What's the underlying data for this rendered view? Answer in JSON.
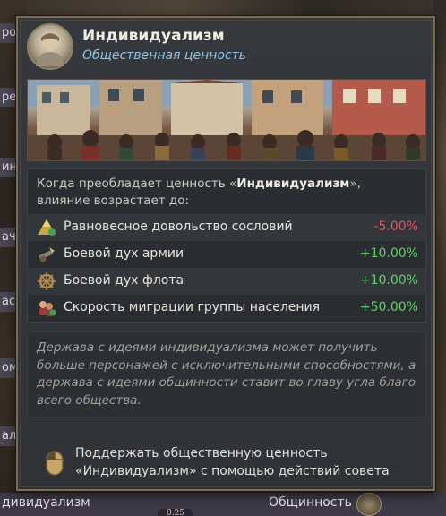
{
  "background": {
    "left_labels": [
      "рон",
      "реп",
      "ин",
      "ач",
      "аст",
      "ом",
      "али"
    ],
    "bottom_left_tab": "дивидуализм",
    "bottom_right_tab": "Общинность",
    "bottom_badge": "0.25"
  },
  "tooltip": {
    "title": "Индивидуализм",
    "subtitle": "Общественная ценность",
    "intro_prefix": "Когда преобладает ценность «",
    "intro_value": "Индивидуализм",
    "intro_suffix": "», влияние возрастает до:",
    "effects": [
      {
        "icon": "estate-pyramid-icon",
        "label": "Равновесное довольство сословий",
        "value": "-5.00%",
        "kind": "neg"
      },
      {
        "icon": "cannon-icon",
        "label": "Боевой дух армии",
        "value": "+10.00%",
        "kind": "pos"
      },
      {
        "icon": "ship-wheel-icon",
        "label": "Боевой дух флота",
        "value": "+10.00%",
        "kind": "pos"
      },
      {
        "icon": "migration-icon",
        "label": "Скорость миграции группы населения",
        "value": "+50.00%",
        "kind": "pos"
      }
    ],
    "description": "Держава с идеями индивидуализма может получить больше персонажей с исключительными способностями, а держава с идеями общинности ставит во главу угла благо всего общества.",
    "action_line1": "Поддержать общественную ценность",
    "action_line2_value": "Индивидуализм",
    "action_line2_suffix": " с помощью действий совета"
  },
  "colors": {
    "subtitle": "#8ec5ea",
    "negative": "#e0575a",
    "positive": "#5fd36a",
    "border": "#7d6c52"
  }
}
